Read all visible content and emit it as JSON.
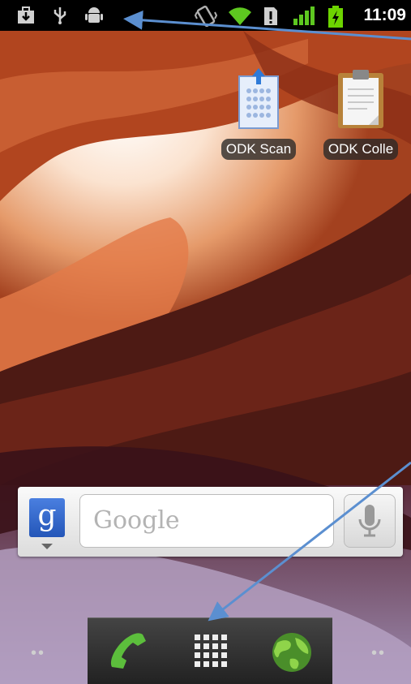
{
  "status_bar": {
    "time": "11:09",
    "left_icons": [
      "download-icon",
      "usb-icon",
      "android-debug-icon"
    ],
    "right_icons": [
      "vibrate-icon",
      "wifi-icon",
      "sim-alert-icon",
      "signal-icon",
      "battery-charging-icon"
    ]
  },
  "apps": [
    {
      "label": "ODK Scan",
      "icon": "odk-scan-icon"
    },
    {
      "label": "ODK Colle",
      "icon": "odk-collect-icon"
    }
  ],
  "search_widget": {
    "placeholder": "Google",
    "provider_letter": "g"
  },
  "dock": {
    "items": [
      "phone-icon",
      "app-drawer-icon",
      "browser-icon"
    ]
  },
  "colors": {
    "status_bar_bg": "#000000",
    "arrow": "#5b8fd0",
    "battery": "#6dd400",
    "wifi": "#5ec820"
  }
}
